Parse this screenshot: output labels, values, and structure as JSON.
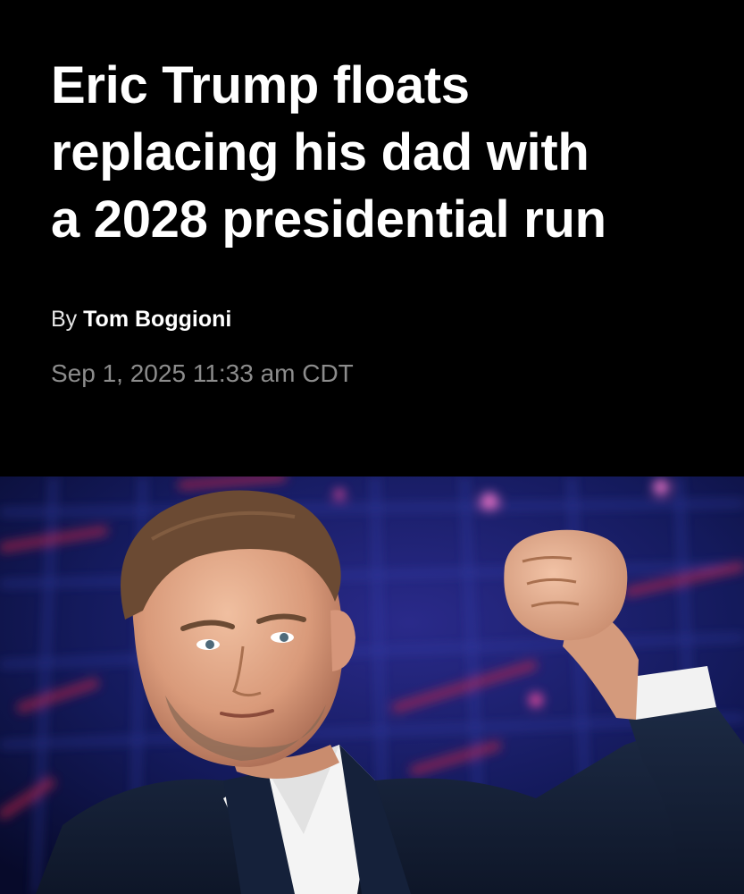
{
  "article": {
    "headline_lines": [
      "Eric Trump floats",
      "replacing his dad with",
      "a 2028 presidential run"
    ],
    "byline_prefix": "By",
    "author": "Tom Boggioni",
    "timestamp": "Sep 1, 2025 11:33 am CDT"
  },
  "colors": {
    "background": "#000000",
    "headline": "#ffffff",
    "timestamp": "#8c8c8c"
  },
  "photo": {
    "icon": "article-hero-photo"
  }
}
